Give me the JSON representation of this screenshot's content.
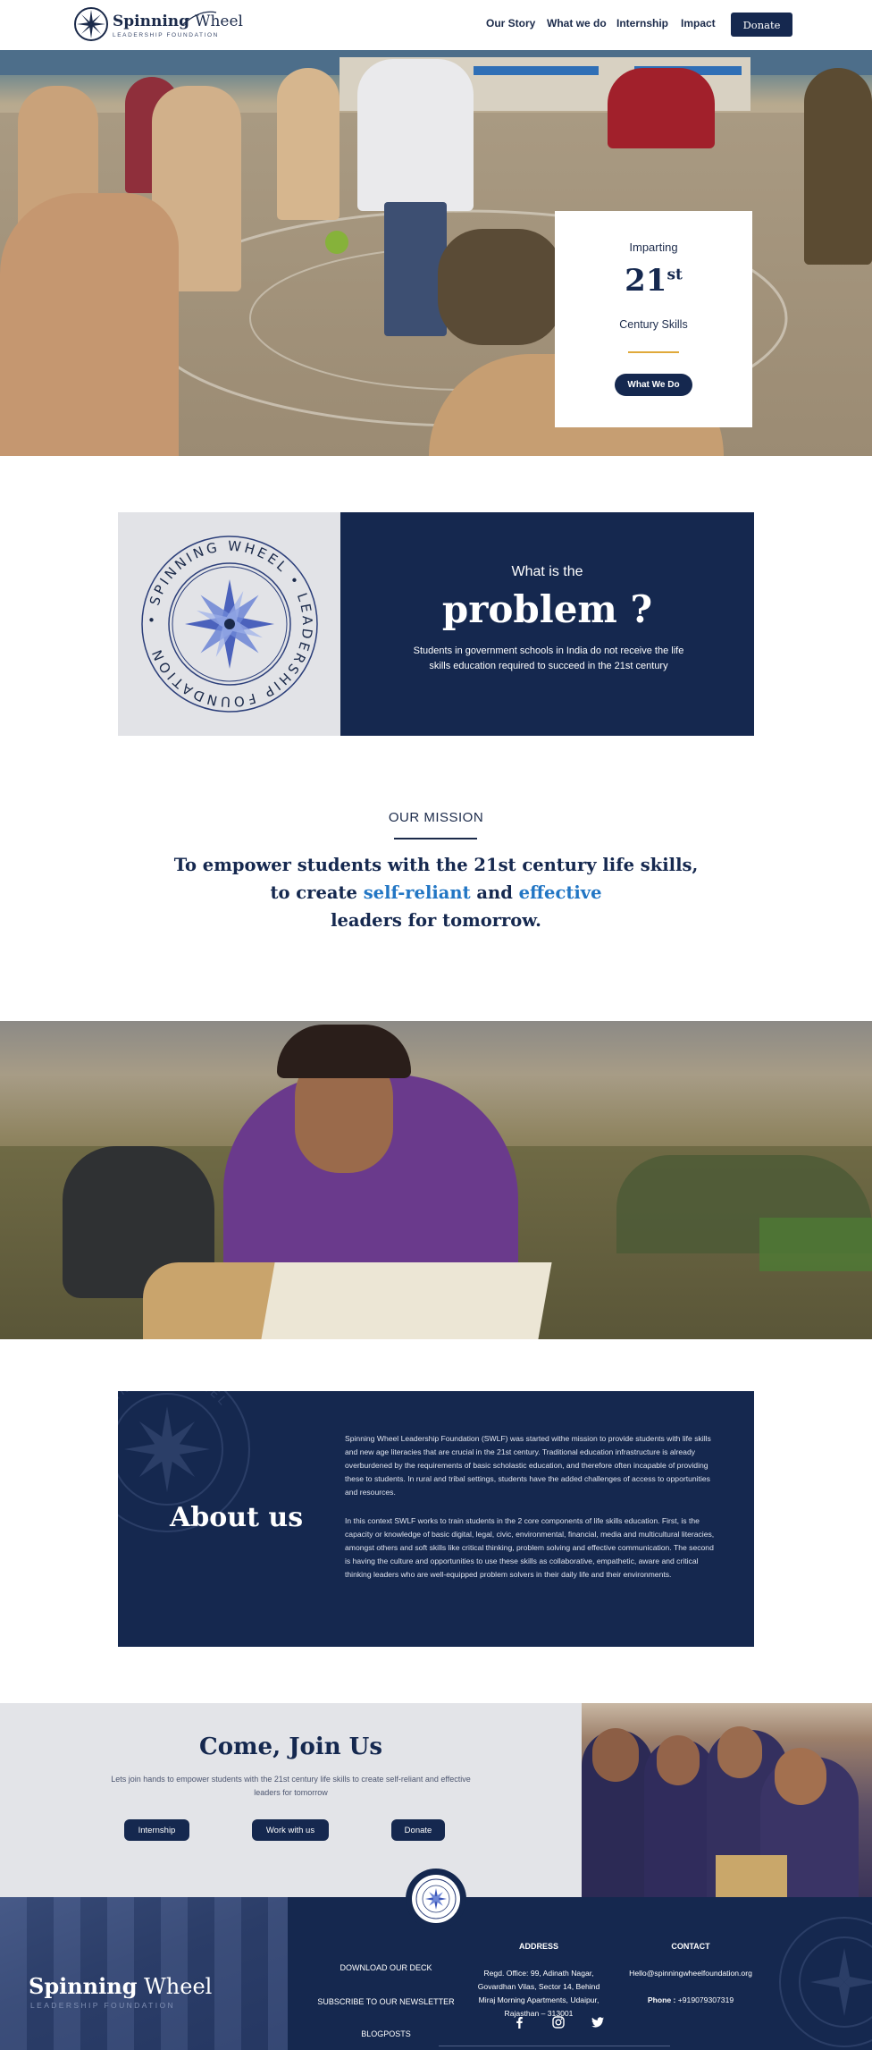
{
  "header": {
    "logo_title_bold": "Spinning",
    "logo_title_light": "Wheel",
    "logo_subtitle": "LEADERSHIP FOUNDATION",
    "nav": [
      "Our Story",
      "What we do",
      "Internship",
      "Impact"
    ],
    "donate_label": "Donate"
  },
  "hero": {
    "kicker": "Imparting",
    "number": "21",
    "number_suffix": "st",
    "caption": "Century Skills",
    "button_label": "What We Do"
  },
  "problem": {
    "seal_text": "• SPINNING WHEEL • LEADERSHIP FOUNDATION",
    "kicker": "What is the",
    "title": "problem ?",
    "text": "Students in government schools in India do not receive the life skills education required to succeed in the 21st century"
  },
  "mission": {
    "label": "OUR MISSION",
    "line1": "To empower students with the 21st century life skills,",
    "line2_a": "to create ",
    "line2_hl1": "self-reliant",
    "line2_b": " and ",
    "line2_hl2": "effective",
    "line3": "leaders for tomorrow."
  },
  "about": {
    "watermark_text": "SPINNING WHEEL",
    "title": "About us",
    "p1": "Spinning Wheel Leadership Foundation (SWLF) was started withe mission to provide students with life skills and new age literacies that are crucial in the 21st century. Traditional education infrastructure is already overburdened by the requirements of basic scholastic education, and therefore often incapable of providing these to students. In rural and tribal settings, students have the added challenges of access to opportunities and resources.",
    "p2": "In this context SWLF works to train students in the 2 core components of life skills education. First, is the capacity or knowledge of basic digital, legal, civic, environmental, financial, media and multicultural literacies, amongst others and soft skills like critical thinking, problem solving and effective communication. The second is having the culture and opportunities to use these skills as collaborative, empathetic, aware and critical thinking leaders who are well-equipped problem solvers in their daily life and their environments."
  },
  "join": {
    "title": "Come, Join Us",
    "text": "Lets join hands to empower students with the 21st century life skills to create self-reliant and effective leaders for tomorrow",
    "buttons": [
      "Internship",
      "Work with us",
      "Donate"
    ]
  },
  "footer": {
    "brand_bold": "Spinning",
    "brand_light": "Wheel",
    "tagline": "LEADERSHIP FOUNDATION",
    "links": [
      "DOWNLOAD OUR DECK",
      "SUBSCRIBE TO OUR NEWSLETTER",
      "BLOGPOSTS"
    ],
    "address_heading": "ADDRESS",
    "address_lines": [
      "Regd. Office: 99, Adinath Nagar,",
      "Govardhan Vilas, Sector 14, Behind",
      "Miraj Morning Apartments, Udaipur,",
      "Rajasthan – 313001"
    ],
    "contact_heading": "CONTACT",
    "email": "Hello@spinningwheelfoundation.org",
    "phone_label": "Phone :",
    "phone": " +919079307319",
    "social": [
      "facebook-icon",
      "instagram-icon",
      "twitter-icon"
    ]
  },
  "colors": {
    "navy": "#15284f",
    "accent_blue": "#2276c4",
    "gold": "#e0a93a",
    "light_gray": "#e3e4e8"
  }
}
